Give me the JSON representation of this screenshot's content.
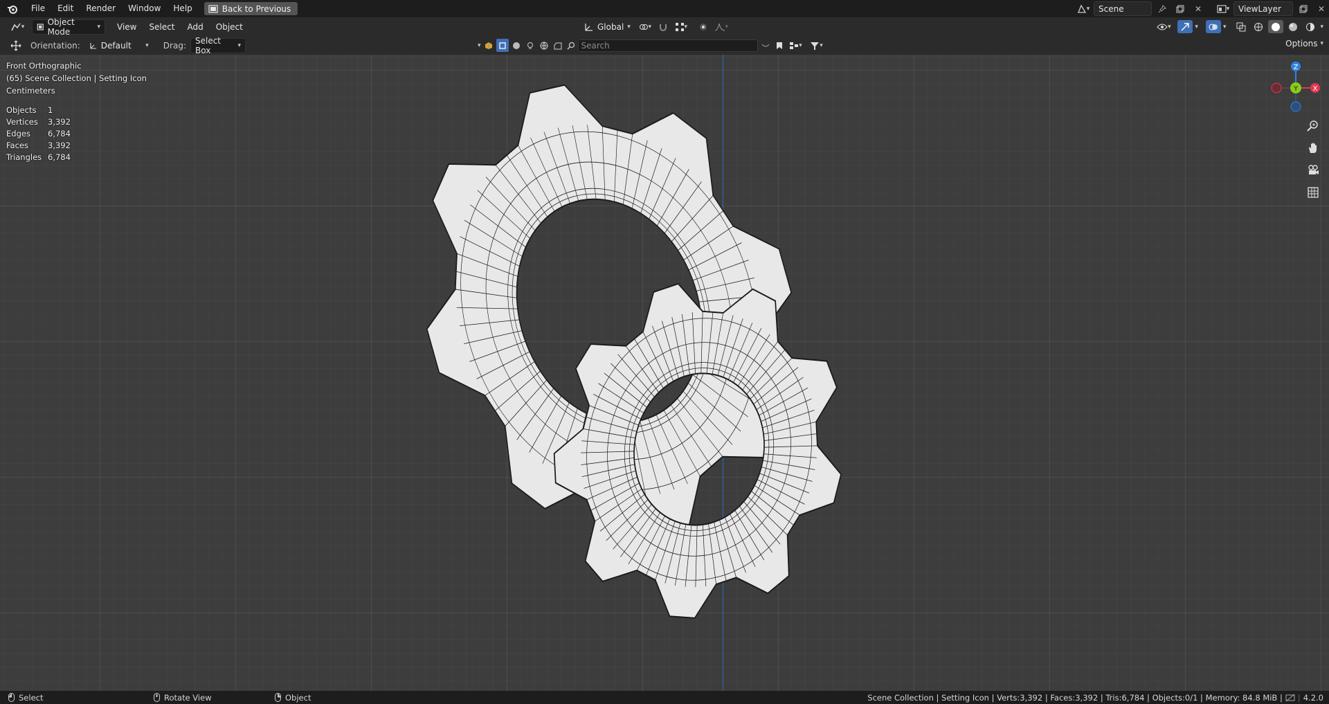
{
  "topbar": {
    "menu": [
      "File",
      "Edit",
      "Render",
      "Window",
      "Help"
    ],
    "back_button": "Back to Previous",
    "scene_name": "Scene",
    "view_layer": "ViewLayer"
  },
  "header": {
    "mode": "Object Mode",
    "menus": [
      "View",
      "Select",
      "Add",
      "Object"
    ],
    "transform_orientation": "Global",
    "options": "Options"
  },
  "tool_settings": {
    "orientation_label": "Orientation:",
    "orientation_value": "Default",
    "drag_label": "Drag:",
    "drag_value": "Select Box",
    "search_placeholder": "Search"
  },
  "viewport": {
    "view_name": "Front Orthographic",
    "collection_line": "(65) Scene Collection | Setting Icon",
    "units": "Centimeters",
    "stats": [
      {
        "label": "Objects",
        "value": "1"
      },
      {
        "label": "Vertices",
        "value": "3,392"
      },
      {
        "label": "Edges",
        "value": "6,784"
      },
      {
        "label": "Faces",
        "value": "3,392"
      },
      {
        "label": "Triangles",
        "value": "6,784"
      }
    ],
    "gizmo_axes": {
      "z": "Z",
      "y": "Y",
      "x": "X"
    }
  },
  "statusbar": {
    "left": [
      "Select",
      "Rotate View",
      "Object"
    ],
    "info": "Scene Collection | Setting Icon | Verts:3,392 | Faces:3,392 | Tris:6,784 | Objects:0/1 | Memory: 84.8 MiB |",
    "version": "4.2.0"
  },
  "colors": {
    "x_axis": "#e0384f",
    "y_axis": "#8acb1b",
    "z_axis": "#2f83e0",
    "mesh_face": "#e8e8e8",
    "mesh_wire": "#1a1a1a"
  }
}
